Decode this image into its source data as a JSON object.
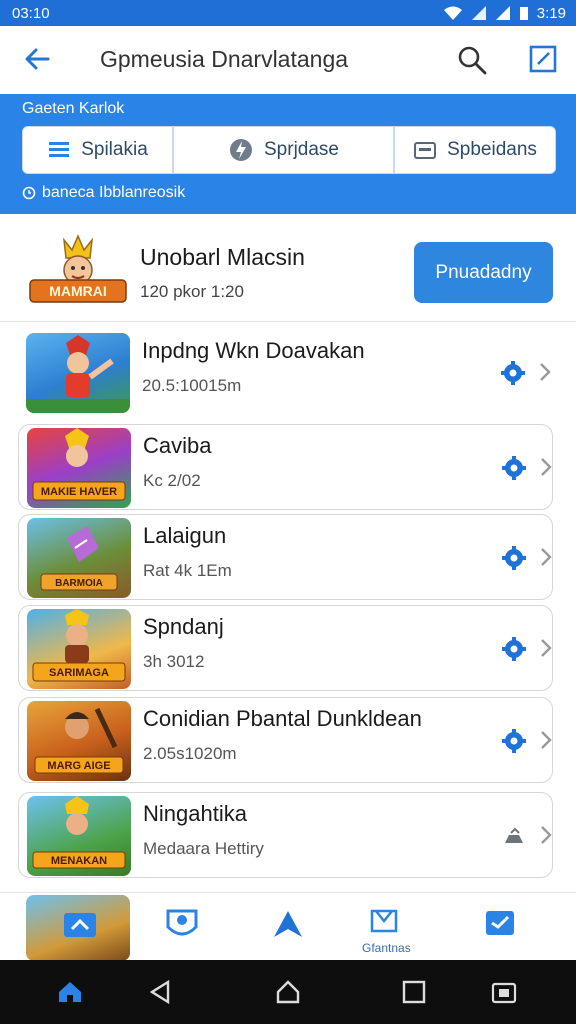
{
  "status_bar": {
    "time": "03:10",
    "right_time": "3:19"
  },
  "app_bar": {
    "title": "Gpmeusia Dnarvlatanga"
  },
  "header": {
    "label": "Gaeten  Karlok",
    "filters": [
      {
        "label": "Spilakia",
        "icon": "list-icon"
      },
      {
        "label": "Sprjdase",
        "icon": "bolt-icon"
      },
      {
        "label": "Spbeidans",
        "icon": "folder-icon"
      }
    ],
    "sub_label": "baneca  Ibblanreosik"
  },
  "featured": {
    "name": "Unobarl Mlacsin",
    "meta": "120 pkor 1:20",
    "logo_text": "MAMRAI",
    "action_label": "Pnuadadny"
  },
  "games": [
    {
      "title": "Inpdng Wkn Doavakan",
      "meta": "20.5:10015m",
      "caption": "",
      "accent": "#3d9be9"
    },
    {
      "title": "Caviba",
      "meta": "Kc 2/02",
      "caption": "MAKIE HAVER",
      "accent": "#8e44ad"
    },
    {
      "title": "Lalaigun",
      "meta": "Rat 4k 1Em",
      "caption": "BARMOIA",
      "accent": "#2f9e5a"
    },
    {
      "title": "Spndanj",
      "meta": "3h 3012",
      "caption": "SARIMAGA",
      "accent": "#e49b2c"
    },
    {
      "title": "Conidian Pbantal Dunkldean",
      "meta": "2.05s1020m",
      "caption": "MARG AIGE",
      "accent": "#c96a1b"
    },
    {
      "title": "Ningahtika",
      "meta": "Medaara Hettiry",
      "caption": "MENAKAN",
      "accent": "#3aa0d8"
    }
  ],
  "bottom_nav": {
    "label": "Gfantnas"
  },
  "colors": {
    "primary": "#2a83e6",
    "appbar_accent": "#1f6fd6",
    "gear": "#1f72d8"
  }
}
